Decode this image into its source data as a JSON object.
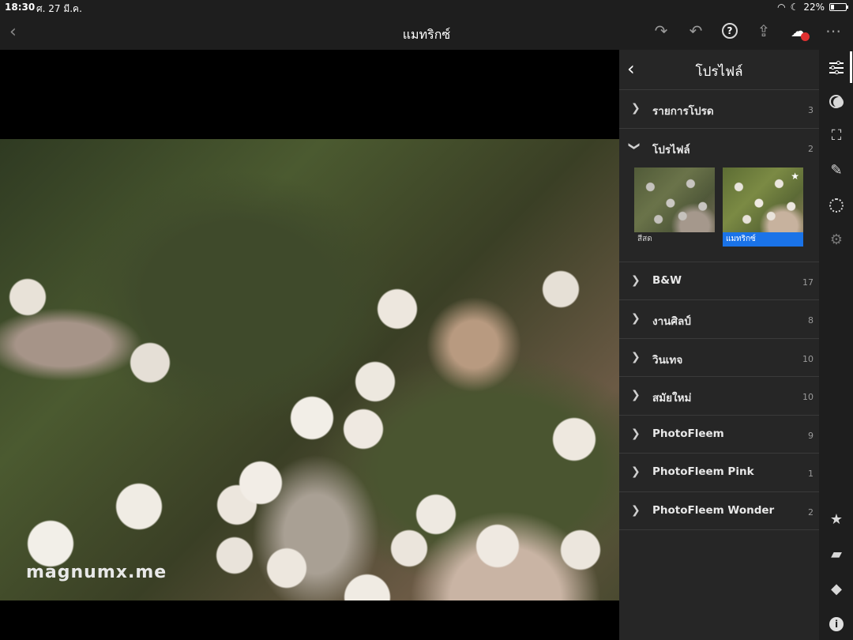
{
  "status_bar": {
    "time": "18:30",
    "date": "ศ. 27 มี.ค.",
    "battery": "22%"
  },
  "top_bar": {
    "title": "แมทริกซ์"
  },
  "watermark": "magnumx.me",
  "panel": {
    "title": "โปรไฟล์",
    "groups": [
      {
        "label": "รายการโปรด",
        "count": "3"
      },
      {
        "label": "โปรไฟล์",
        "count": "2",
        "expanded": true
      },
      {
        "label": "B&W",
        "count": "17"
      },
      {
        "label": "งานศิลป์",
        "count": "8"
      },
      {
        "label": "วินเทจ",
        "count": "10"
      },
      {
        "label": "สมัยใหม่",
        "count": "10"
      },
      {
        "label": "PhotoFleem",
        "count": "9"
      },
      {
        "label": "PhotoFleem Pink",
        "count": "1"
      },
      {
        "label": "PhotoFleem Wonder",
        "count": "2"
      }
    ],
    "profiles": [
      {
        "label": "สีสด",
        "selected": false
      },
      {
        "label": "แมทริกซ์",
        "selected": true
      }
    ]
  },
  "colors": {
    "accent": "#1a73e8",
    "panel_bg": "#262626",
    "badge": "#e03030"
  }
}
